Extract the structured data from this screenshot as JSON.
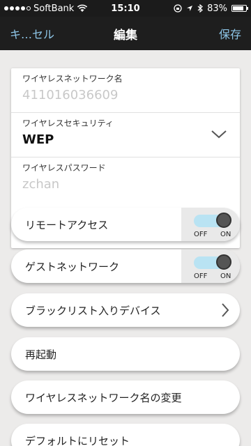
{
  "statusbar": {
    "carrier": "SoftBank",
    "time": "15:10",
    "battery": "83%",
    "battery_level": 0.83,
    "icons": [
      "signal-dots",
      "wifi-icon",
      "rotation-lock-icon",
      "location-icon",
      "bluetooth-icon",
      "battery-icon"
    ]
  },
  "nav": {
    "cancel_label": "キ…セル",
    "title": "編集",
    "save_label": "保存"
  },
  "form": {
    "ssid": {
      "label": "ワイヤレスネットワーク名",
      "value": "41101603660​9"
    },
    "security": {
      "label": "ワイヤレスセキュリティ",
      "value": "WEP"
    },
    "password": {
      "label": "ワイヤレスパスワード",
      "value": "zchan"
    }
  },
  "toggles": {
    "off_label": "OFF",
    "on_label": "ON",
    "remote_access": {
      "label": "リモートアクセス",
      "state": "on"
    },
    "guest_network": {
      "label": "ゲストネットワーク",
      "state": "on"
    }
  },
  "menu": {
    "blacklist": "ブラックリスト入りデバイス",
    "reboot": "再起動",
    "rename_ssid": "ワイヤレスネットワーク名の変更",
    "factory_reset": "デフォルトにリセット"
  },
  "colors": {
    "accent": "#8ec6e8",
    "toggle_track": "#b9e3f3",
    "navbar": "#1e1e1e"
  }
}
